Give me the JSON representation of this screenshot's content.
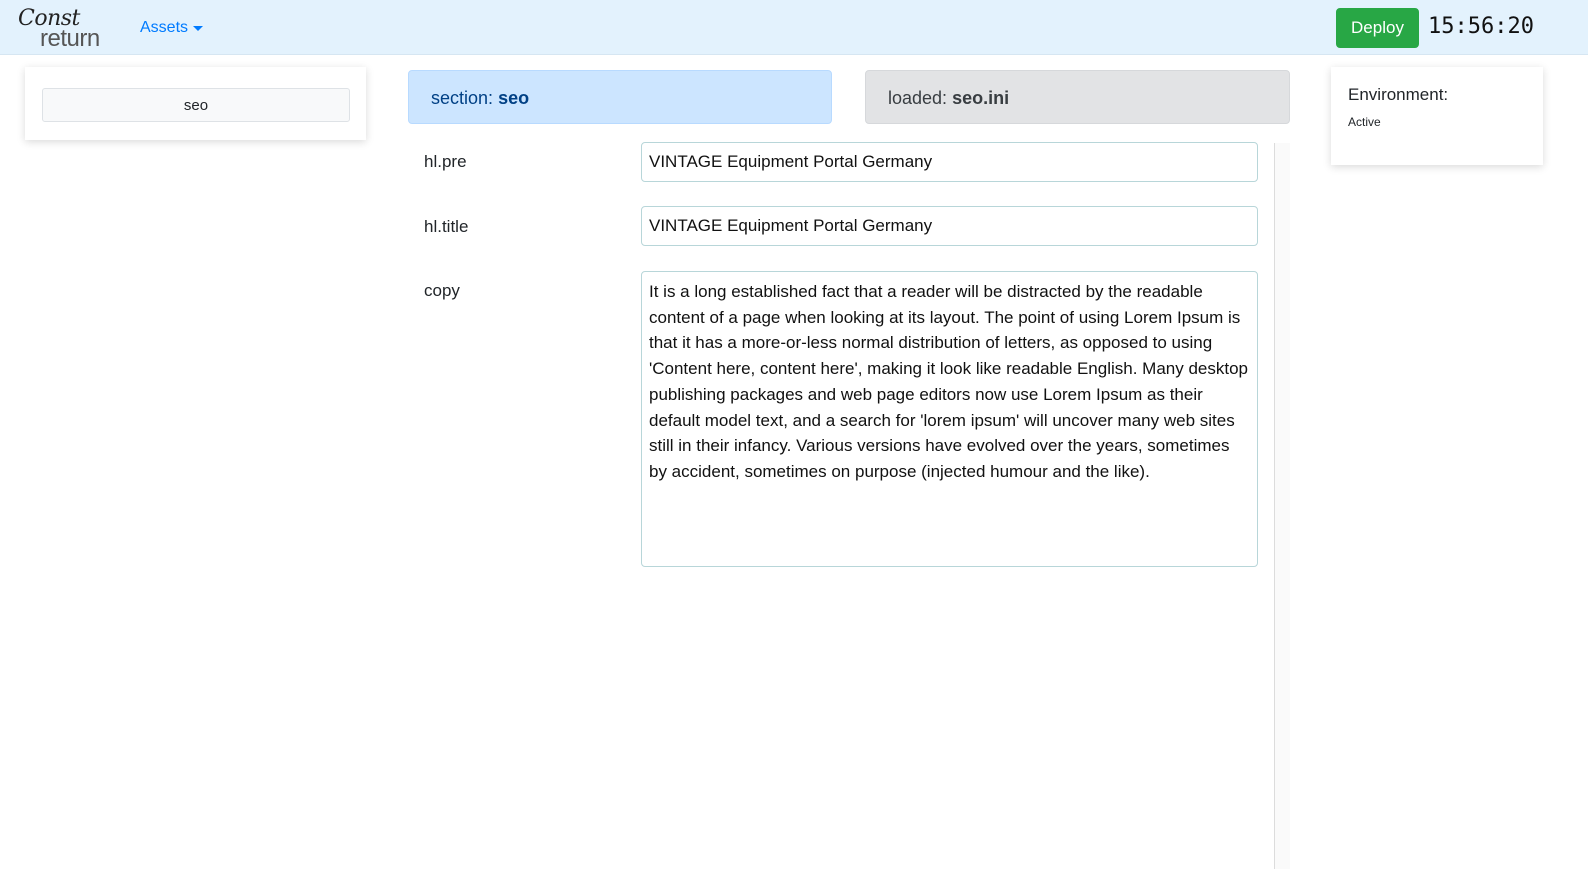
{
  "navbar": {
    "logo_line1": "Const",
    "logo_line2": "return",
    "assets_label": "Assets",
    "deploy_label": "Deploy",
    "clock": "15:56:20"
  },
  "sidebar": {
    "section_button": "seo"
  },
  "section_alert": {
    "prefix": "section:",
    "value": "seo"
  },
  "loaded_alert": {
    "prefix": "loaded:",
    "value": "seo.ini"
  },
  "fields": [
    {
      "label": "hl.pre",
      "value": "VINTAGE Equipment Portal Germany"
    },
    {
      "label": "hl.title",
      "value": "VINTAGE Equipment Portal Germany"
    },
    {
      "label": "copy",
      "value": "It is a long established fact that a reader will be distracted by the readable content of a page when looking at its layout. The point of using Lorem Ipsum is that it has a more-or-less normal distribution of letters, as opposed to using 'Content here, content here', making it look like readable English. Many desktop publishing packages and web page editors now use Lorem Ipsum as their default model text, and a search for 'lorem ipsum' will uncover many web sites still in their infancy. Various versions have evolved over the years, sometimes by accident, sometimes on purpose (injected humour and the like)."
    }
  ],
  "environment": {
    "title": "Environment:",
    "status": "Active"
  },
  "colors": {
    "navbar_bg": "#e3f2fd",
    "deploy_bg": "#28a745",
    "link": "#007bff",
    "info_alert_bg": "#cce5ff",
    "secondary_alert_bg": "#e2e3e5"
  }
}
